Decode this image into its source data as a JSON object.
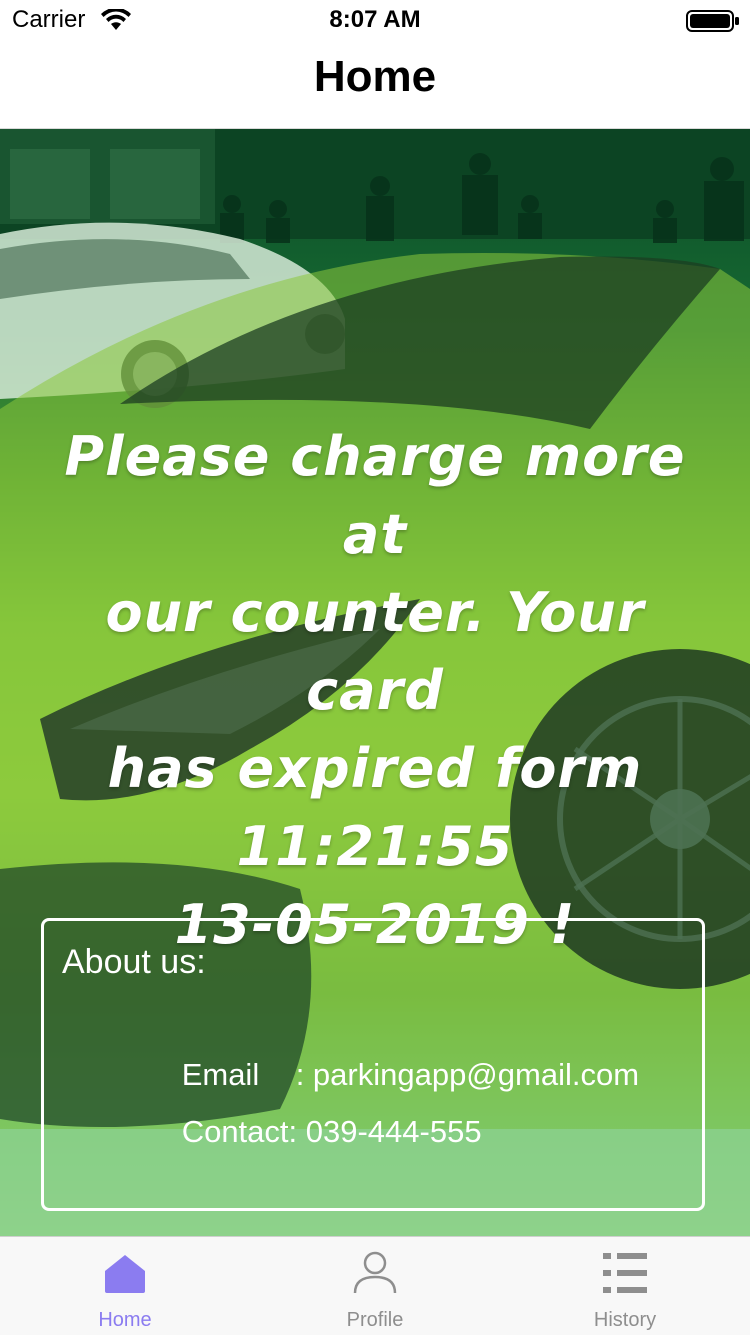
{
  "status_bar": {
    "carrier": "Carrier",
    "time": "8:07 AM"
  },
  "nav": {
    "title": "Home"
  },
  "notice": {
    "lines": [
      "Please charge more at",
      "our counter. Your card",
      "has expired form",
      "11:21:55",
      "13-05-2019 !"
    ]
  },
  "about": {
    "title": "About us:",
    "email_label": "Email",
    "email_value": ": parkingapp@gmail.com",
    "contact_label": "Contact:",
    "contact_value": " 039-444-555"
  },
  "tabs": [
    {
      "label": "Home",
      "icon": "home-icon",
      "active": true
    },
    {
      "label": "Profile",
      "icon": "person-icon",
      "active": false
    },
    {
      "label": "History",
      "icon": "list-icon",
      "active": false
    }
  ],
  "colors": {
    "tab_active": "#8b7cf0",
    "tab_inactive": "#8e8e8e",
    "hero_overlay": "#2e8b3e"
  }
}
